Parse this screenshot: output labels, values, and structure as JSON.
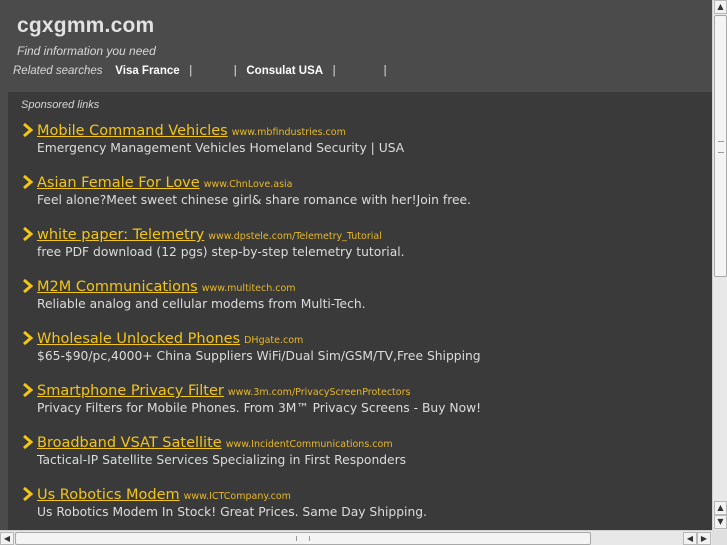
{
  "header": {
    "title": "cgxgmm.com",
    "tagline": "Find information you need",
    "related_label": "Related searches",
    "related": [
      "Visa France",
      "",
      "Consulat USA",
      ""
    ],
    "separator": "|"
  },
  "main": {
    "sponsored_label": "Sponsored links",
    "arrow_icon": "chevron-right-icon",
    "accent_color": "#f3c518",
    "ads": [
      {
        "title": "Mobile Command Vehicles",
        "url": "www.mbfindustries.com",
        "desc": "Emergency Management Vehicles Homeland Security | USA"
      },
      {
        "title": "Asian Female For Love",
        "url": "www.ChnLove.asia",
        "desc": "Feel alone?Meet sweet chinese girl& share romance with her!Join free."
      },
      {
        "title": "white paper: Telemetry",
        "url": "www.dpstele.com/Telemetry_Tutorial",
        "desc": "free PDF download (12 pgs) step-by-step telemetry tutorial."
      },
      {
        "title": "M2M Communications",
        "url": "www.multitech.com",
        "desc": "Reliable analog and cellular modems from Multi-Tech."
      },
      {
        "title": "Wholesale Unlocked Phones",
        "url": "DHgate.com",
        "desc": "$65-$90/pc,4000+ China Suppliers WiFi/Dual Sim/GSM/TV,Free Shipping"
      },
      {
        "title": "Smartphone Privacy Filter",
        "url": "www.3m.com/PrivacyScreenProtectors",
        "desc": "Privacy Filters for Mobile Phones. From 3M™ Privacy Screens - Buy Now!"
      },
      {
        "title": "Broadband VSAT Satellite",
        "url": "www.IncidentCommunications.com",
        "desc": "Tactical-IP Satellite Services Specializing in First Responders"
      },
      {
        "title": "Us Robotics Modem",
        "url": "www.ICTCompany.com",
        "desc": "Us Robotics Modem In Stock! Great Prices. Same Day Shipping."
      }
    ]
  },
  "scrollbars": {
    "up_glyph": "▲",
    "down_glyph": "▼",
    "left_glyph": "◀",
    "right_glyph": "▶"
  }
}
